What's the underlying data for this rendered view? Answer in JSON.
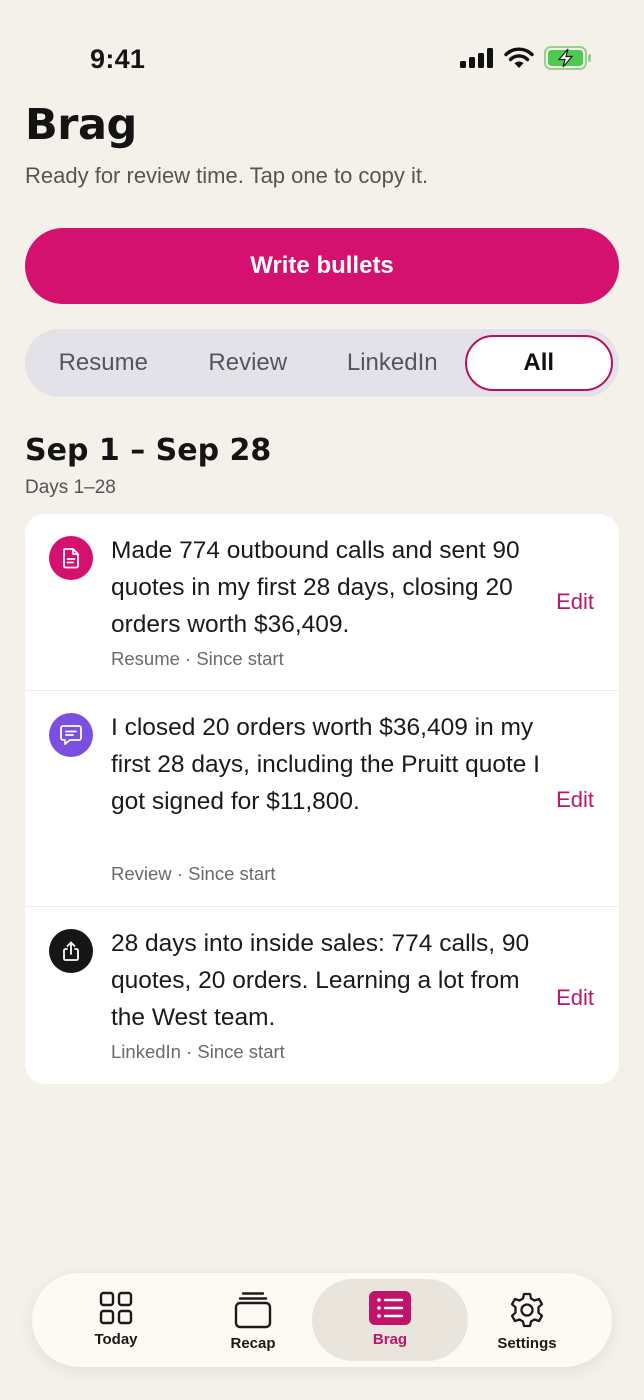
{
  "status": {
    "time": "9:41"
  },
  "header": {
    "title": "Brag",
    "subtitle": "Ready for review time. Tap one to copy it."
  },
  "actions": {
    "write_bullets": "Write bullets"
  },
  "filters": {
    "options": [
      "Resume",
      "Review",
      "LinkedIn",
      "All"
    ],
    "selected": "All"
  },
  "section": {
    "title": "Sep 1 – Sep 28",
    "subtitle": "Days 1–28"
  },
  "entries": [
    {
      "text": "Made 774 outbound calls and sent 90 quotes in my first 28 days, closing 20 orders worth $36,409.",
      "meta": "Resume · Since start",
      "edit": "Edit",
      "icon": "document-icon",
      "color": "#d4116e"
    },
    {
      "text": "I closed 20 orders worth $36,409 in my first 28 days, including the Pruitt quote I got signed for $11,800.",
      "meta": "Review · Since start",
      "edit": "Edit",
      "icon": "chat-bubble-icon",
      "color": "#7b4fe0"
    },
    {
      "text": "28 days into inside sales: 774 calls, 90 quotes, 20 orders. Learning a lot from the West team.",
      "meta": "LinkedIn · Since start",
      "edit": "Edit",
      "icon": "share-icon",
      "color": "#161616"
    }
  ],
  "tabs": [
    {
      "label": "Today",
      "icon": "grid-icon"
    },
    {
      "label": "Recap",
      "icon": "stack-icon"
    },
    {
      "label": "Brag",
      "icon": "list-icon",
      "active": true
    },
    {
      "label": "Settings",
      "icon": "gear-icon"
    }
  ],
  "colors": {
    "accent": "#d4116e",
    "background": "#f4f0ea"
  }
}
